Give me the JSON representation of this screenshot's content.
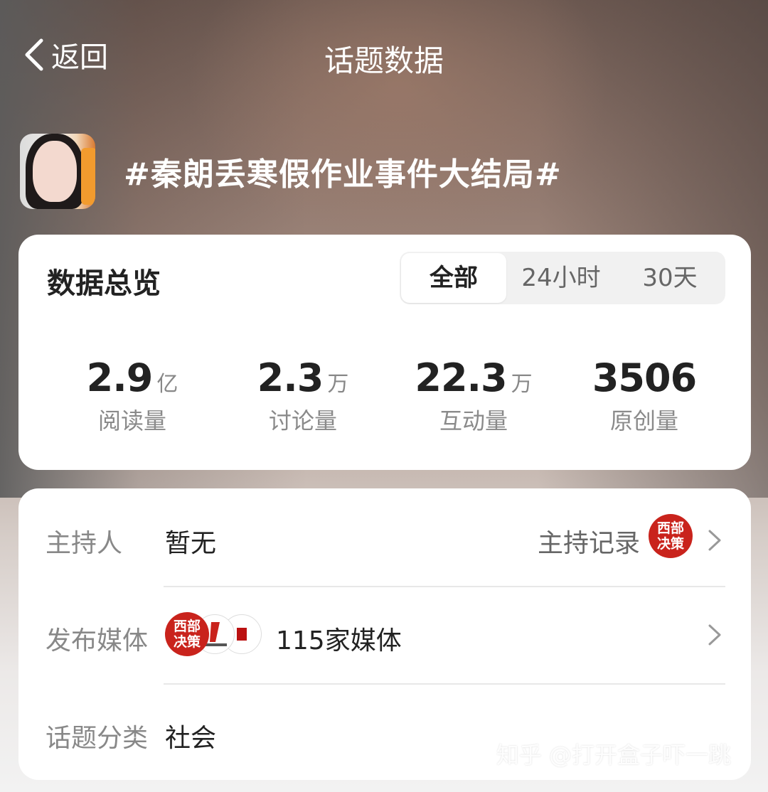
{
  "nav": {
    "back_label": "返回",
    "title": "话题数据"
  },
  "topic": {
    "title": "#秦朗丢寒假作业事件大结局#"
  },
  "overview": {
    "title": "数据总览",
    "tabs": [
      "全部",
      "24小时",
      "30天"
    ],
    "selected_tab": "全部",
    "stats": [
      {
        "value": "2.9",
        "unit": "亿",
        "label": "阅读量"
      },
      {
        "value": "2.3",
        "unit": "万",
        "label": "讨论量"
      },
      {
        "value": "22.3",
        "unit": "万",
        "label": "互动量"
      },
      {
        "value": "3506",
        "unit": "",
        "label": "原创量"
      }
    ]
  },
  "details": {
    "host_label": "主持人",
    "host_value": "暂无",
    "host_record": "主持记录",
    "host_logo_text": [
      "西部",
      "决策"
    ],
    "media_label": "发布媒体",
    "media_logo_text": [
      "西部",
      "决策"
    ],
    "media_count": "115家媒体",
    "category_label": "话题分类",
    "category_value": "社会"
  },
  "watermark": "知乎 @打开盒子吓一跳",
  "colors": {
    "accent_red": "#c9231c",
    "card_bg": "#ffffff"
  }
}
